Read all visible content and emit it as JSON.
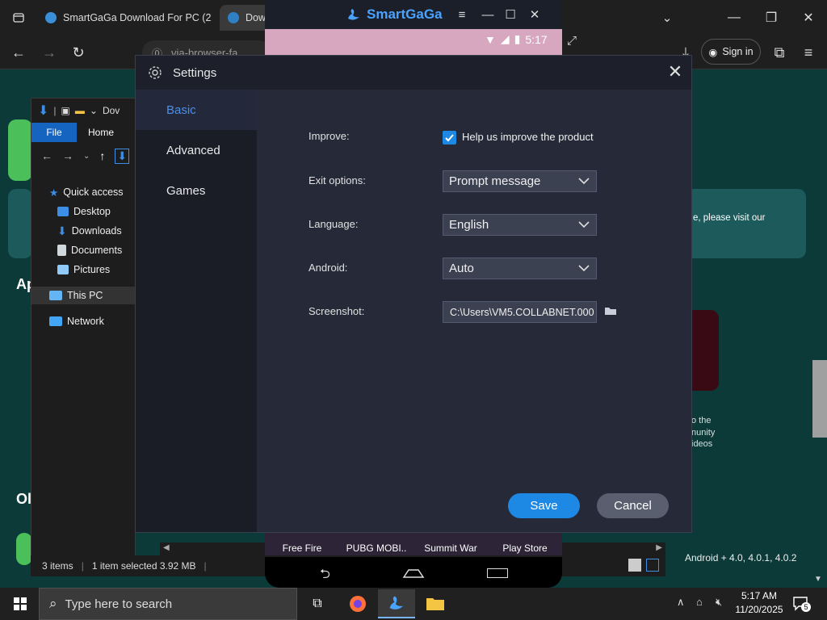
{
  "browser": {
    "tab1_title": "SmartGaGa Download For PC (2",
    "tab2_title": "Down",
    "address_text": "via-browser-fa",
    "signin_label": "Sign in"
  },
  "page": {
    "visit_text": "e, please visit our",
    "desc_line1": "o the",
    "desc_line2": "nunity",
    "desc_line3": "ideos",
    "android_versions": "Android + 4.0, 4.0.1, 4.0.2",
    "section_ap": "Ap",
    "section_ol": "Ol"
  },
  "explorer": {
    "title_fragment": "Dov",
    "ribbon_file": "File",
    "ribbon_home": "Home",
    "nav": [
      {
        "label": "Quick access",
        "icon": "star-icon"
      },
      {
        "label": "Desktop",
        "icon": "desktop-folder-icon"
      },
      {
        "label": "Downloads",
        "icon": "downloads-icon"
      },
      {
        "label": "Documents",
        "icon": "documents-icon"
      },
      {
        "label": "Pictures",
        "icon": "pictures-icon"
      },
      {
        "label": "This PC",
        "icon": "computer-icon"
      },
      {
        "label": "Network",
        "icon": "network-icon"
      }
    ],
    "status_items": "3 items",
    "status_selected": "1 item selected  3.92 MB"
  },
  "settings": {
    "title": "Settings",
    "sidebar": [
      "Basic",
      "Advanced",
      "Games"
    ],
    "active_tab": "Basic",
    "improve_label": "Improve:",
    "improve_checkbox_label": "Help us improve the product",
    "improve_checked": true,
    "exit_label": "Exit options:",
    "exit_value": "Prompt message",
    "language_label": "Language:",
    "language_value": "English",
    "android_label": "Android:",
    "android_value": "Auto",
    "screenshot_label": "Screenshot:",
    "screenshot_path": "C:\\Users\\VM5.COLLABNET.000",
    "save_label": "Save",
    "cancel_label": "Cancel"
  },
  "emulator": {
    "brand": "SmartGaGa",
    "time": "5:17",
    "apps": [
      "Free Fire",
      "PUBG MOBI..",
      "Summit War",
      "Play Store"
    ]
  },
  "taskbar": {
    "search_placeholder": "Type here to search",
    "time": "5:17 AM",
    "date": "11/20/2025",
    "notification_count": "5"
  },
  "colors": {
    "accent": "#1e88e5",
    "page_bg": "#0b3a38",
    "dialog_bg": "#262a38",
    "sidebar_active_text": "#4a8fe8"
  }
}
